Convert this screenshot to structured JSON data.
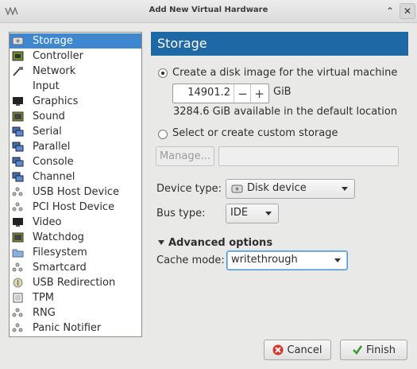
{
  "window": {
    "title": "Add New Virtual Hardware",
    "app_icon": "virt-manager-icon",
    "up_button": "⌃",
    "close_button": "✕"
  },
  "sidebar": {
    "items": [
      {
        "label": "Storage",
        "icon": "storage-icon",
        "selected": true
      },
      {
        "label": "Controller",
        "icon": "controller-icon"
      },
      {
        "label": "Network",
        "icon": "network-icon"
      },
      {
        "label": "Input",
        "icon": "input-icon"
      },
      {
        "label": "Graphics",
        "icon": "graphics-icon"
      },
      {
        "label": "Sound",
        "icon": "sound-icon"
      },
      {
        "label": "Serial",
        "icon": "serial-icon"
      },
      {
        "label": "Parallel",
        "icon": "parallel-icon"
      },
      {
        "label": "Console",
        "icon": "console-icon"
      },
      {
        "label": "Channel",
        "icon": "channel-icon"
      },
      {
        "label": "USB Host Device",
        "icon": "usb-host-icon"
      },
      {
        "label": "PCI Host Device",
        "icon": "pci-host-icon"
      },
      {
        "label": "Video",
        "icon": "video-icon"
      },
      {
        "label": "Watchdog",
        "icon": "watchdog-icon"
      },
      {
        "label": "Filesystem",
        "icon": "filesystem-icon"
      },
      {
        "label": "Smartcard",
        "icon": "smartcard-icon"
      },
      {
        "label": "USB Redirection",
        "icon": "usb-redirection-icon"
      },
      {
        "label": "TPM",
        "icon": "tpm-icon"
      },
      {
        "label": "RNG",
        "icon": "rng-icon"
      },
      {
        "label": "Panic Notifier",
        "icon": "panic-notifier-icon"
      }
    ]
  },
  "storage": {
    "header": "Storage",
    "create_disk_label": "Create a disk image for the virtual machine",
    "create_disk_selected": true,
    "size_value": "14901.2",
    "size_minus": "−",
    "size_plus": "+",
    "size_unit": "GiB",
    "available_text": "3284.6 GiB available in the default location",
    "custom_storage_label": "Select or create custom storage",
    "custom_storage_selected": false,
    "manage_button": "Manage...",
    "custom_path_value": "",
    "device_type_label": "Device type:",
    "device_type_value": "Disk device",
    "bus_type_label": "Bus type:",
    "bus_type_value": "IDE",
    "advanced_label": "Advanced options",
    "advanced_expanded": true,
    "cache_mode_label": "Cache mode:",
    "cache_mode_value": "writethrough"
  },
  "footer": {
    "cancel_label": "Cancel",
    "finish_label": "Finish"
  },
  "colors": {
    "selection": "#3f88d0",
    "header_bg": "#1f68a6",
    "cancel_icon": "#d9342b",
    "finish_icon": "#3a9a2e"
  }
}
